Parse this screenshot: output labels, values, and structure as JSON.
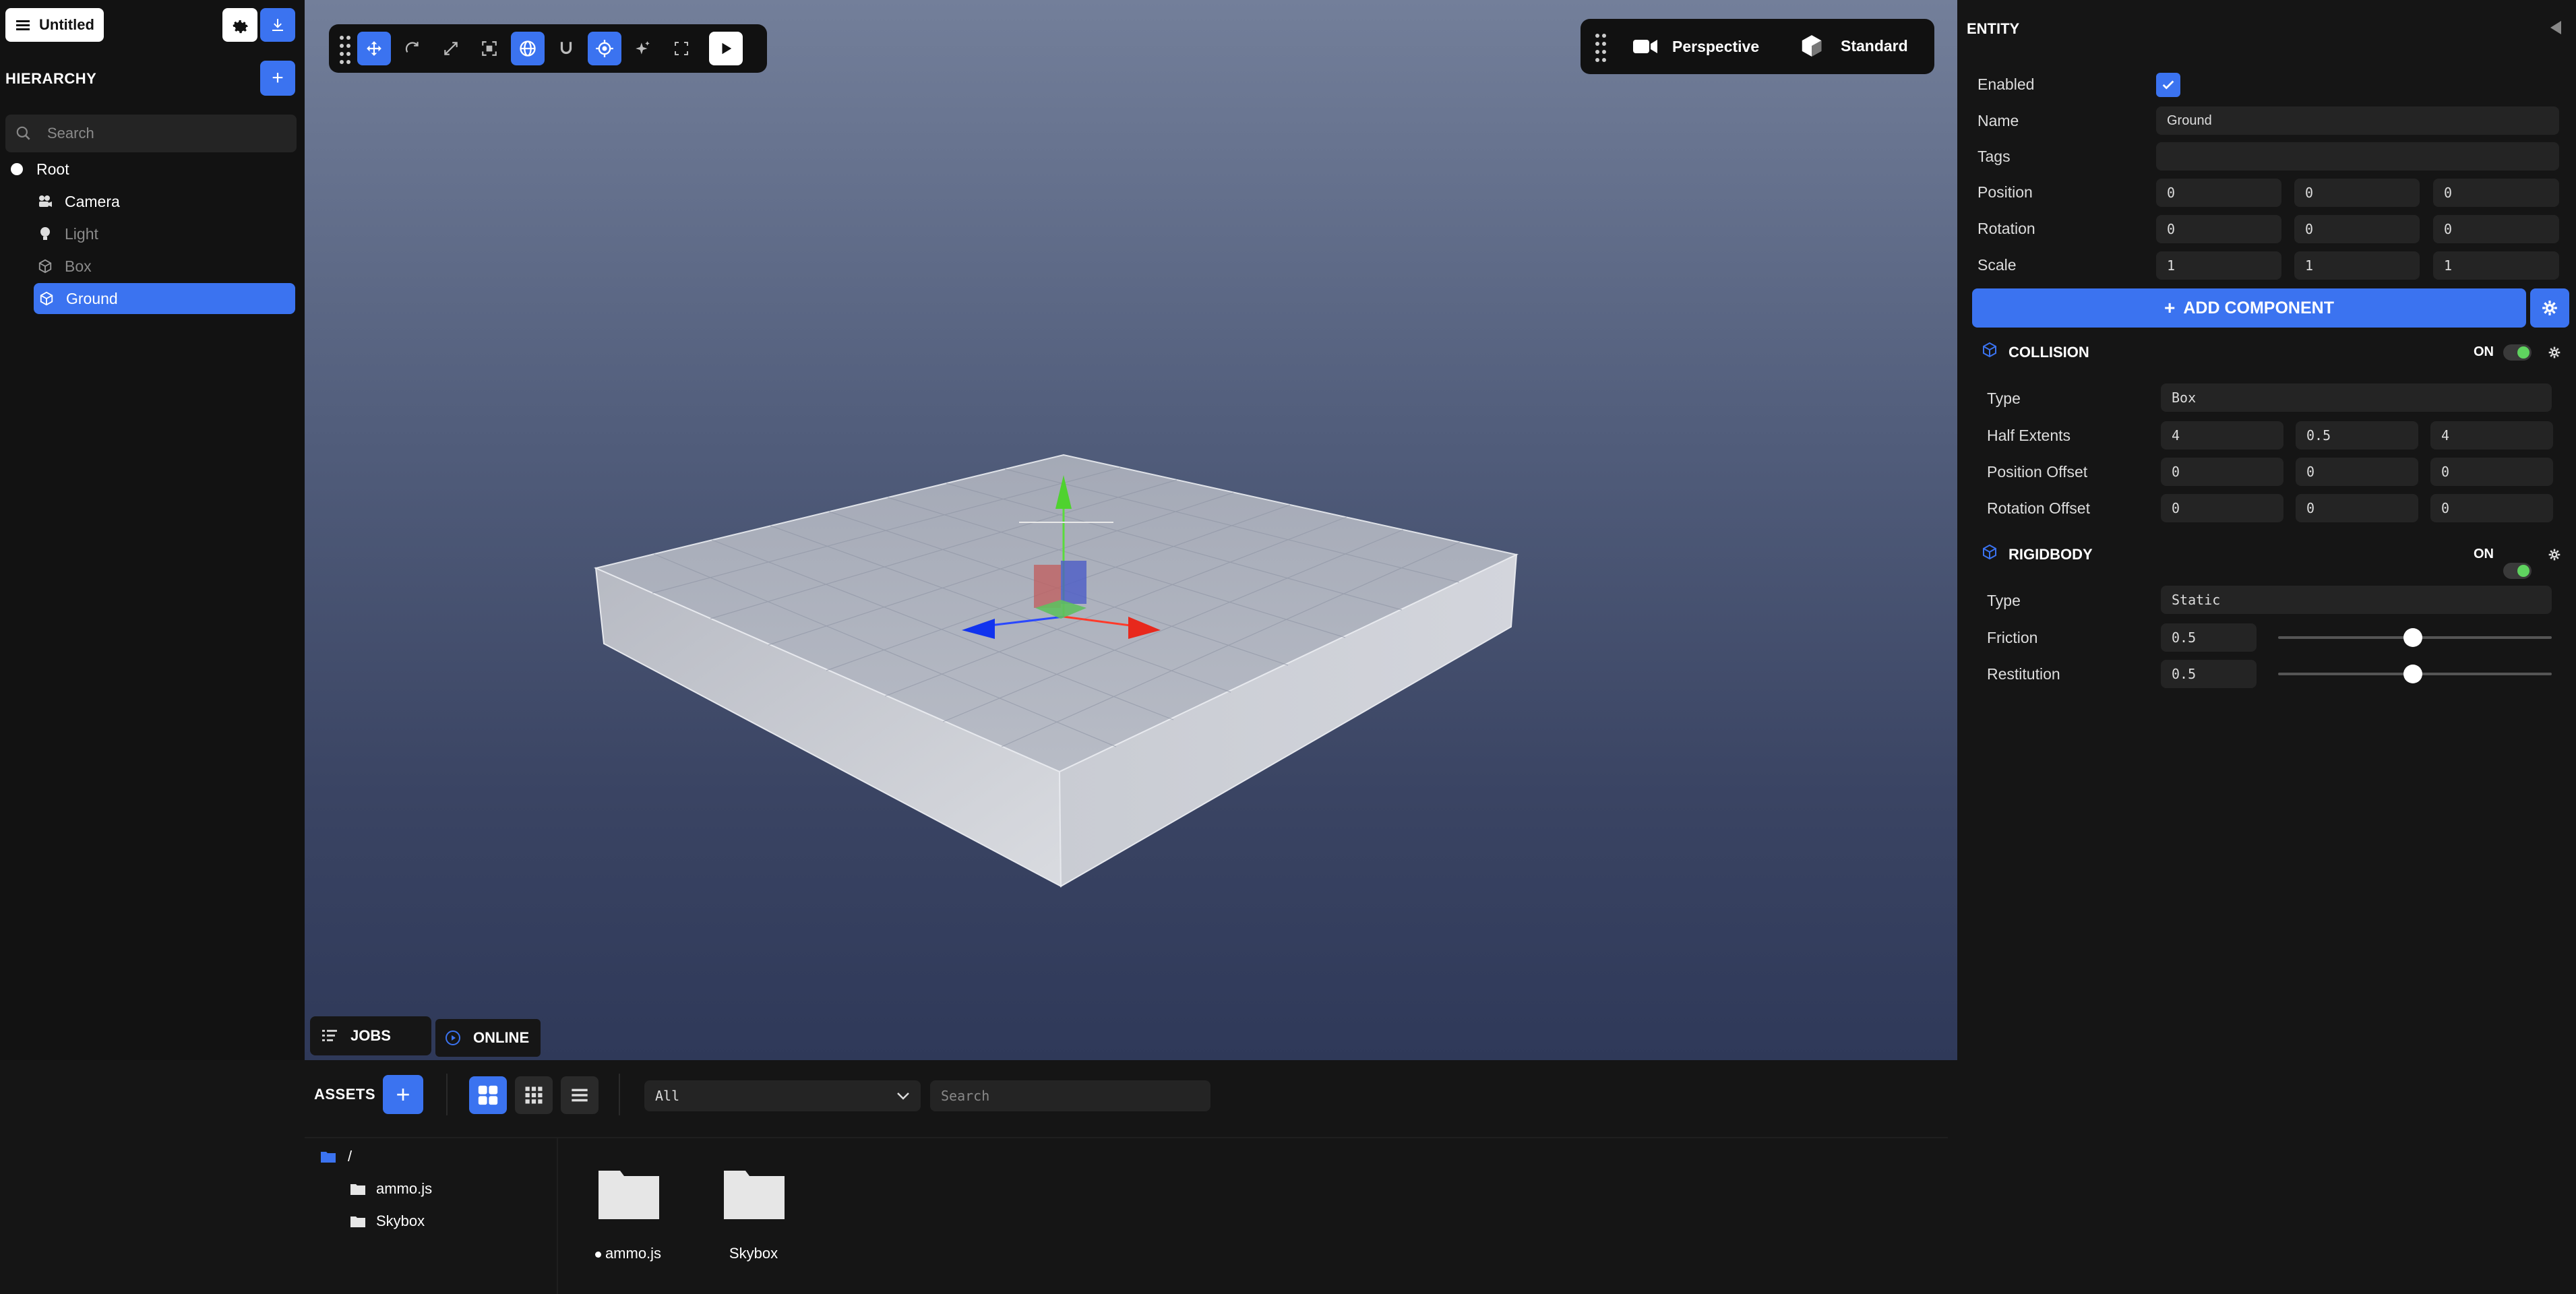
{
  "project": {
    "title": "Untitled"
  },
  "hierarchy": {
    "title": "HIERARCHY",
    "search_placeholder": "Search",
    "items": [
      {
        "label": "Root"
      },
      {
        "label": "Camera"
      },
      {
        "label": "Light"
      },
      {
        "label": "Box"
      },
      {
        "label": "Ground"
      }
    ]
  },
  "viewport": {
    "camera_mode": "Perspective",
    "render_mode": "Standard",
    "tabs": {
      "jobs": "JOBS",
      "online": "ONLINE"
    }
  },
  "inspector": {
    "title": "ENTITY",
    "enabled_label": "Enabled",
    "name_label": "Name",
    "name_value": "Ground",
    "tags_label": "Tags",
    "tags_value": "",
    "position_label": "Position",
    "position": [
      "0",
      "0",
      "0"
    ],
    "rotation_label": "Rotation",
    "rotation": [
      "0",
      "0",
      "0"
    ],
    "scale_label": "Scale",
    "scale": [
      "1",
      "1",
      "1"
    ],
    "add_component": "ADD COMPONENT",
    "collision": {
      "title": "COLLISION",
      "state": "ON",
      "type_label": "Type",
      "type_value": "Box",
      "half_extents_label": "Half Extents",
      "half_extents": [
        "4",
        "0.5",
        "4"
      ],
      "position_offset_label": "Position Offset",
      "position_offset": [
        "0",
        "0",
        "0"
      ],
      "rotation_offset_label": "Rotation Offset",
      "rotation_offset": [
        "0",
        "0",
        "0"
      ]
    },
    "rigidbody": {
      "title": "RIGIDBODY",
      "state": "ON",
      "type_label": "Type",
      "type_value": "Static",
      "friction_label": "Friction",
      "friction_value": "0.5",
      "restitution_label": "Restitution",
      "restitution_value": "0.5"
    }
  },
  "assets": {
    "title": "ASSETS",
    "filter_value": "All",
    "search_placeholder": "Search",
    "tree": {
      "root": "/",
      "folders": [
        "ammo.js",
        "Skybox"
      ]
    },
    "items": [
      "ammo.js",
      "Skybox"
    ]
  },
  "colors": {
    "accent": "#3b73f0",
    "toggle_on": "#5fd35f"
  }
}
